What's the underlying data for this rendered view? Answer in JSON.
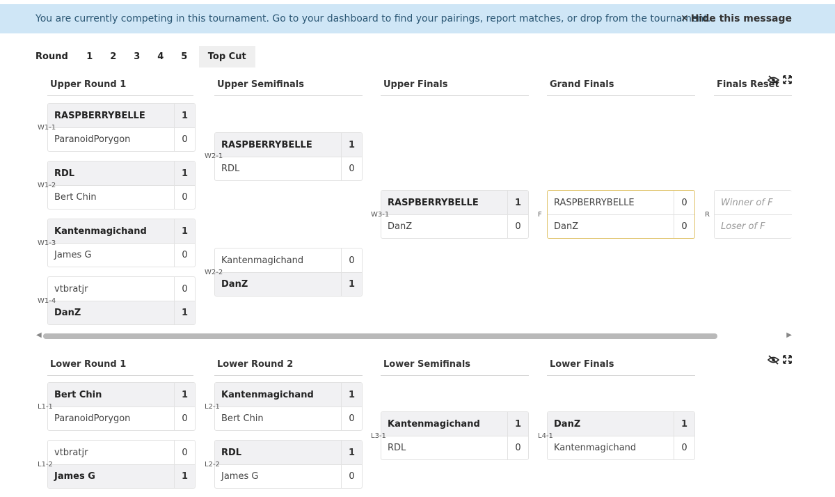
{
  "banner": {
    "message": "You are currently competing in this tournament. Go to your dashboard to find your pairings, report matches, or drop from the tournament.",
    "hide_label": "Hide this message",
    "hide_icon": "✕"
  },
  "round_nav": {
    "label": "Round",
    "rounds": [
      "1",
      "2",
      "3",
      "4",
      "5"
    ],
    "top_cut": "Top Cut"
  },
  "upper": {
    "headers": [
      "Upper Round 1",
      "Upper Semifinals",
      "Upper Finals",
      "Grand Finals",
      "Finals Reset"
    ],
    "matches": [
      {
        "id": "W1-1",
        "p1": "RASPBERRYBELLE",
        "s1": "1",
        "p2": "ParanoidPorygon",
        "s2": "0"
      },
      {
        "id": "W1-2",
        "p1": "RDL",
        "s1": "1",
        "p2": "Bert Chin",
        "s2": "0"
      },
      {
        "id": "W1-3",
        "p1": "Kantenmagichand",
        "s1": "1",
        "p2": "James G",
        "s2": "0"
      },
      {
        "id": "W1-4",
        "p1": "vtbratjr",
        "s1": "0",
        "p2": "DanZ",
        "s2": "1"
      },
      {
        "id": "W2-1",
        "p1": "RASPBERRYBELLE",
        "s1": "1",
        "p2": "RDL",
        "s2": "0"
      },
      {
        "id": "W2-2",
        "p1": "Kantenmagichand",
        "s1": "0",
        "p2": "DanZ",
        "s2": "1"
      },
      {
        "id": "W3-1",
        "p1": "RASPBERRYBELLE",
        "s1": "1",
        "p2": "DanZ",
        "s2": "0"
      },
      {
        "id": "F",
        "p1": "RASPBERRYBELLE",
        "s1": "0",
        "p2": "DanZ",
        "s2": "0"
      },
      {
        "id": "R",
        "p1": "Winner of F",
        "s1": "",
        "p2": "Loser of F",
        "s2": ""
      }
    ]
  },
  "lower": {
    "headers": [
      "Lower Round 1",
      "Lower Round 2",
      "Lower Semifinals",
      "Lower Finals"
    ],
    "matches": [
      {
        "id": "L1-1",
        "p1": "Bert Chin",
        "s1": "1",
        "p2": "ParanoidPorygon",
        "s2": "0"
      },
      {
        "id": "L1-2",
        "p1": "vtbratjr",
        "s1": "0",
        "p2": "James G",
        "s2": "1"
      },
      {
        "id": "L2-1",
        "p1": "Kantenmagichand",
        "s1": "1",
        "p2": "Bert Chin",
        "s2": "0"
      },
      {
        "id": "L2-2",
        "p1": "RDL",
        "s1": "1",
        "p2": "James G",
        "s2": "0"
      },
      {
        "id": "L3-1",
        "p1": "Kantenmagichand",
        "s1": "1",
        "p2": "RDL",
        "s2": "0"
      },
      {
        "id": "L4-1",
        "p1": "DanZ",
        "s1": "1",
        "p2": "Kantenmagichand",
        "s2": "0"
      }
    ]
  },
  "icons": {
    "hide": "eye-slash-icon",
    "expand": "expand-icon",
    "scroll_left": "arrow-left-icon",
    "scroll_right": "arrow-right-icon"
  },
  "colors": {
    "banner_bg": "#cfe6f6",
    "banner_text": "#2b5774",
    "winner_row": "#f1f1f3",
    "grand_final_border": "#e0c36b"
  }
}
